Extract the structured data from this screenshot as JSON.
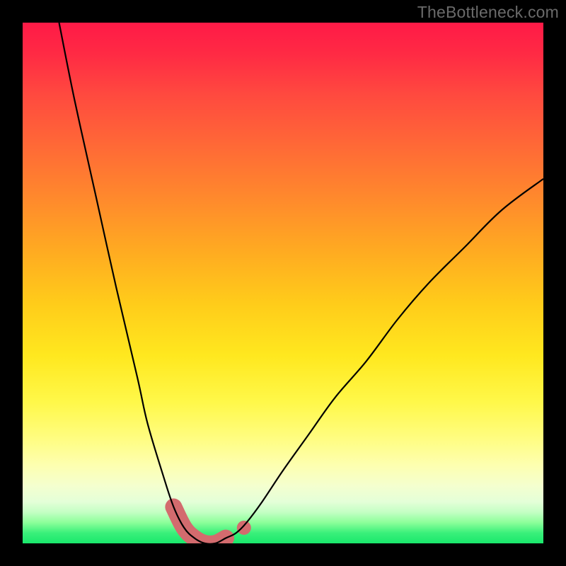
{
  "watermark": "TheBottleneck.com",
  "colors": {
    "border": "#000000",
    "curve_stroke": "#000000",
    "highlight": "#d36b6e",
    "gradient_top": "#ff1a47",
    "gradient_bottom": "#19e86c"
  },
  "chart_data": {
    "type": "line",
    "title": "",
    "xlabel": "",
    "ylabel": "",
    "xlim": [
      0,
      100
    ],
    "ylim": [
      0,
      100
    ],
    "grid": false,
    "note": "No axis ticks or numeric labels are shown in the image; values are inferred on a 0–100 scale from pixel positions.",
    "series": [
      {
        "name": "bottleneck-curve",
        "description": "V-shaped curve: steep left wall starting at x≈7,y≈100 descending to a flat minimum at y≈0 around x≈30–40, then rising more gently to x≈100,y≈70.",
        "x": [
          7,
          10,
          14,
          18,
          22,
          24,
          27,
          29,
          31,
          33,
          35,
          37,
          39,
          41,
          43,
          46,
          50,
          55,
          60,
          66,
          72,
          78,
          85,
          92,
          100
        ],
        "y": [
          100,
          85,
          67,
          49,
          32,
          23,
          13,
          7,
          3,
          1,
          0,
          0,
          1,
          2,
          4,
          8,
          14,
          21,
          28,
          35,
          43,
          50,
          57,
          64,
          70
        ]
      }
    ],
    "highlight": {
      "description": "Thick rounded pink segment along the flat minimum plus one isolated dot just to the right on the ascending slope.",
      "segment_x": [
        29,
        31,
        33,
        35,
        37,
        39
      ],
      "segment_y": [
        7,
        3,
        1,
        0,
        0,
        1
      ],
      "extra_dot": {
        "x": 42.5,
        "y": 3
      }
    }
  }
}
